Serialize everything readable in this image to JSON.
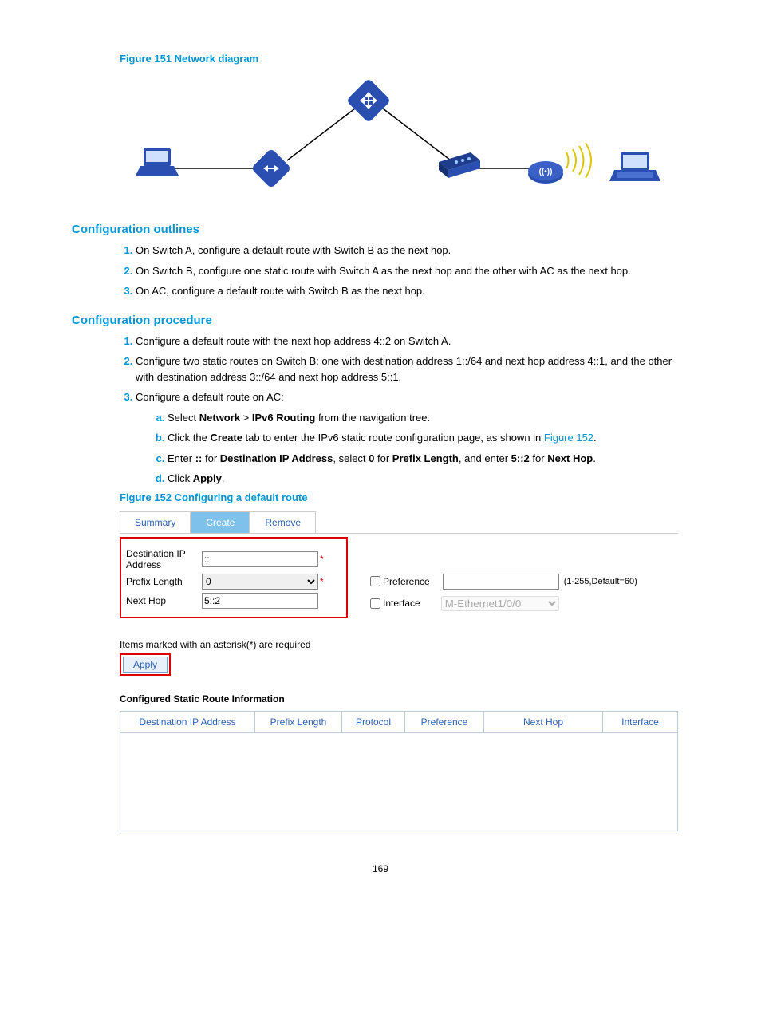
{
  "figure151_title": "Figure 151 Network diagram",
  "section_outlines": "Configuration outlines",
  "outlines": [
    "On Switch A, configure a default route with Switch B as the next hop.",
    "On Switch B, configure one static route with Switch A as the next hop and the other with AC as the next hop.",
    "On AC, configure a default route with Switch B as the next hop."
  ],
  "section_procedure": "Configuration procedure",
  "proc": [
    "Configure a default route with the next hop address 4::2 on Switch A.",
    "Configure two static routes on Switch B: one with destination address 1::/64 and next hop address 4::1, and the other with destination address 3::/64 and next hop address 5::1.",
    "Configure a default route on AC:"
  ],
  "sub": {
    "a_pre": "Select ",
    "a_b1": "Network",
    "a_mid": " > ",
    "a_b2": "IPv6 Routing",
    "a_post": " from the navigation tree.",
    "b_pre": "Click the ",
    "b_b1": "Create",
    "b_mid": " tab to enter the IPv6 static route configuration page, as shown in ",
    "b_link": "Figure 152",
    "b_post": ".",
    "c_pre": "Enter ",
    "c_b1": "::",
    "c_mid1": " for ",
    "c_b2": "Destination IP Address",
    "c_mid2": ", select ",
    "c_b3": "0",
    "c_mid3": " for ",
    "c_b4": "Prefix Length",
    "c_mid4": ", and enter ",
    "c_b5": "5::2",
    "c_mid5": " for ",
    "c_b6": "Next Hop",
    "c_post": ".",
    "d_pre": "Click ",
    "d_b1": "Apply",
    "d_post": "."
  },
  "figure152_title": "Figure 152 Configuring a default route",
  "tabs": {
    "summary": "Summary",
    "create": "Create",
    "remove": "Remove"
  },
  "form": {
    "dest_label": "Destination IP Address",
    "dest_value": "::",
    "prefix_label": "Prefix Length",
    "prefix_value": "0",
    "nexthop_label": "Next Hop",
    "nexthop_value": "5::2",
    "pref_label": "Preference",
    "pref_hint": "(1-255,Default=60)",
    "iface_label": "Interface",
    "iface_value": "M-Ethernet1/0/0"
  },
  "required_note": "Items marked with an asterisk(*) are required",
  "apply_label": "Apply",
  "table_title": "Configured Static Route Information",
  "cols": {
    "c1": "Destination IP Address",
    "c2": "Prefix  Length",
    "c3": "Protocol",
    "c4": "Preference",
    "c5": "Next Hop",
    "c6": "Interface"
  },
  "page_number": "169"
}
